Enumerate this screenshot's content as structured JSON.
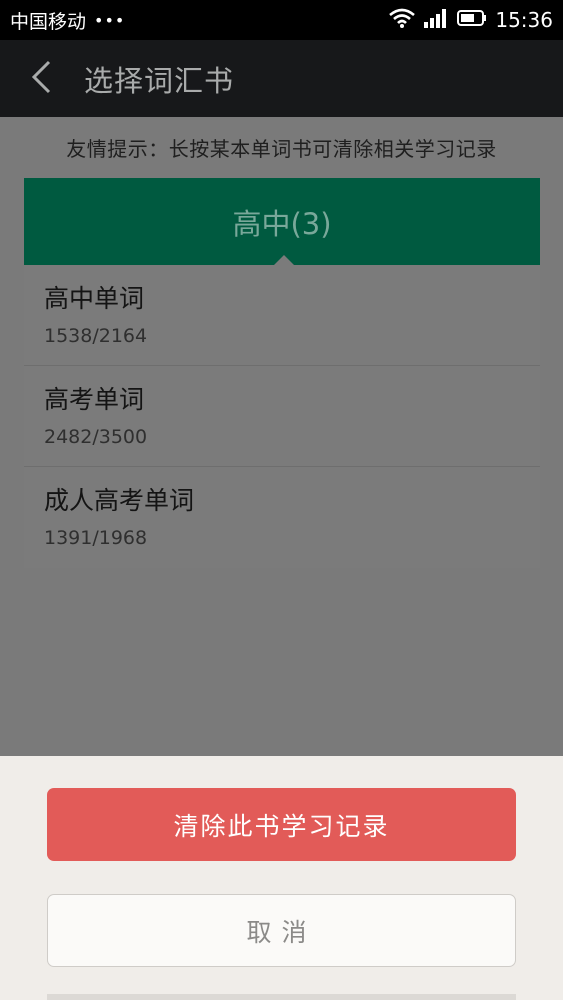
{
  "status_bar": {
    "carrier": "中国移动",
    "dots": "•••",
    "time": "15:36"
  },
  "app_bar": {
    "title": "选择词汇书"
  },
  "hint": "友情提示：长按某本单词书可清除相关学习记录",
  "tab": {
    "label": "高中(3)"
  },
  "books": [
    {
      "title": "高中单词",
      "progress": "1538/2164"
    },
    {
      "title": "高考单词",
      "progress": "2482/3500"
    },
    {
      "title": "成人高考单词",
      "progress": "1391/1968"
    }
  ],
  "sheet": {
    "clear_label": "清除此书学习记录",
    "cancel_label": "取消"
  },
  "icons": {
    "back": "chevron-left-icon",
    "wifi": "wifi-icon",
    "signal": "signal-icon",
    "battery": "battery-icon"
  },
  "colors": {
    "tab_green": "#005a40",
    "clear_red": "#e25b58",
    "app_bar": "#17181a"
  }
}
